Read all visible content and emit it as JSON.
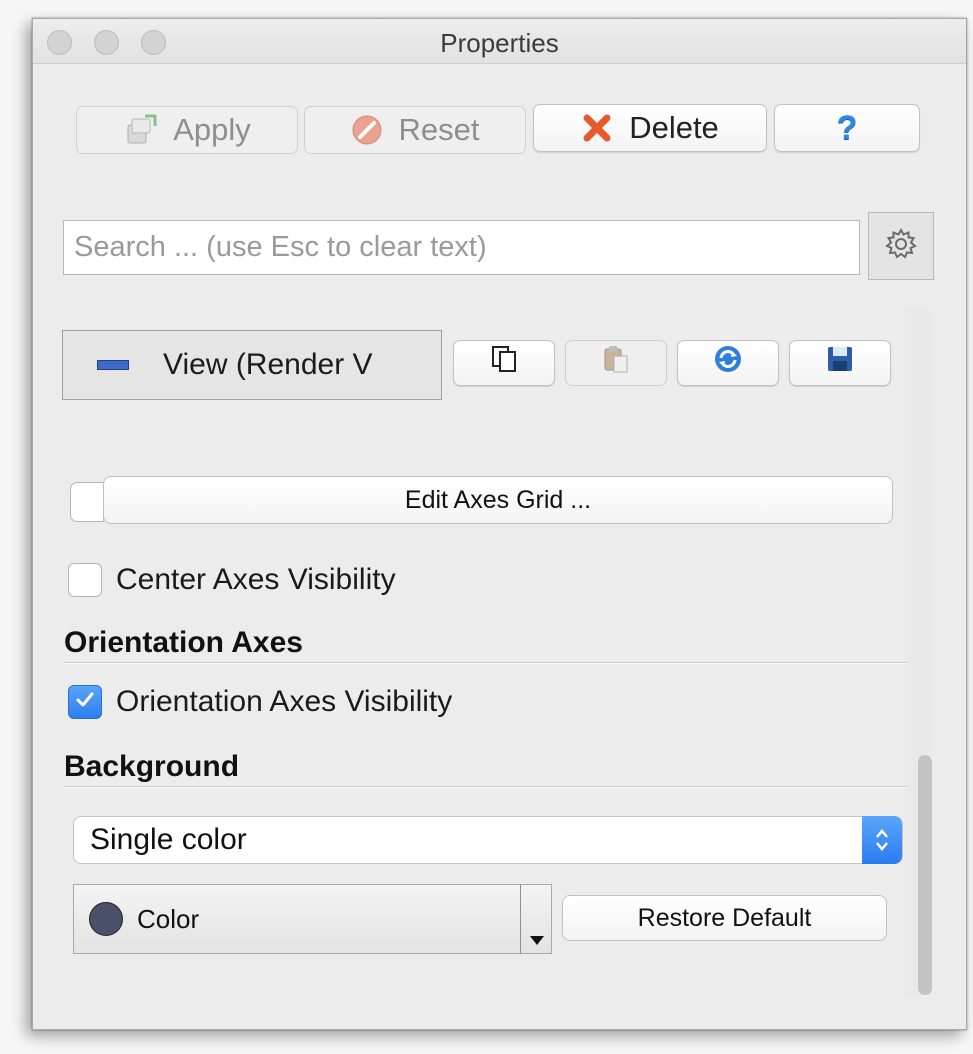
{
  "window": {
    "title": "Properties"
  },
  "toolbar": {
    "apply_label": "Apply",
    "reset_label": "Reset",
    "delete_label": "Delete",
    "help_label": "?"
  },
  "search": {
    "placeholder": "Search ... (use Esc to clear text)",
    "value": ""
  },
  "view": {
    "label": "View (Render V",
    "icons": [
      "copy-icon",
      "paste-icon",
      "refresh-icon",
      "save-icon"
    ]
  },
  "axes_grid": {
    "button_label": "Edit Axes Grid ...",
    "checked": false
  },
  "center_axes": {
    "label": "Center Axes Visibility",
    "checked": false
  },
  "orientation_axes": {
    "section_title": "Orientation Axes",
    "visibility_label": "Orientation Axes Visibility",
    "checked": true
  },
  "background": {
    "section_title": "Background",
    "mode_value": "Single color",
    "color_label": "Color",
    "color_hex": "#4a5068",
    "restore_label": "Restore Default"
  }
}
